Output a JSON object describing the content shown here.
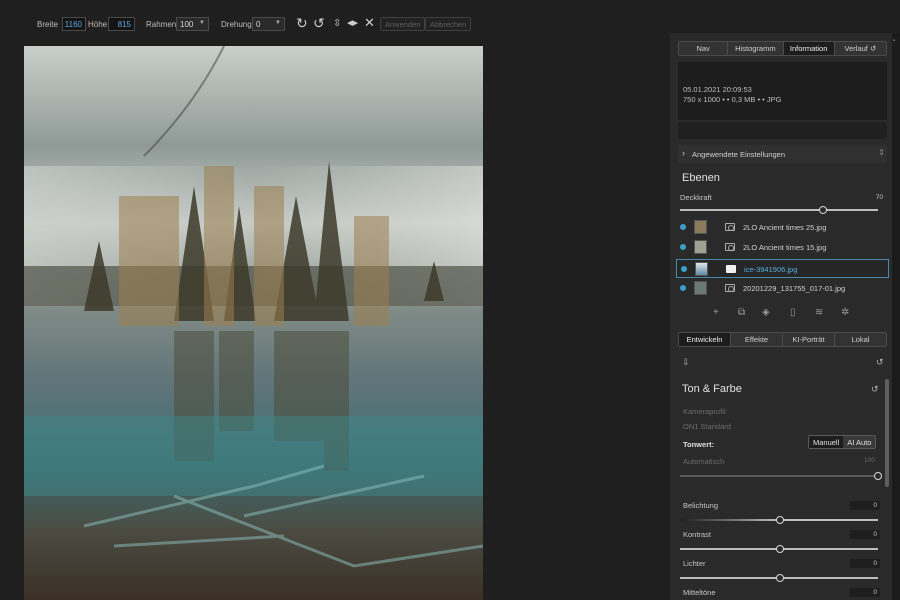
{
  "toolbar": {
    "width_label": "Breite",
    "width_value": "1160",
    "height_label": "Höhe",
    "height_value": "815",
    "frame_label": "Rahmen",
    "frame_value": "100",
    "rotation_label": "Drehung",
    "rotation_value": "0",
    "apply_label": "Anwenden",
    "cancel_label": "Abbrechen",
    "icons": [
      "rotate-cw-icon",
      "rotate-ccw-icon",
      "flip-vertical-icon",
      "flip-horizontal-icon",
      "fit-icon"
    ]
  },
  "panel": {
    "tabs": [
      {
        "label": "Nav"
      },
      {
        "label": "Histogramm"
      },
      {
        "label": "Information"
      },
      {
        "label": "Verlauf"
      }
    ],
    "info": {
      "datetime": "05.01.2021 20:09:53",
      "specs": "750 x 1000 • • 0,3 MB • • JPG"
    },
    "applied_settings": "Angewendete Einstellungen",
    "layers": {
      "title": "Ebenen",
      "opacity_label": "Deckkraft",
      "opacity_value": "70",
      "opacity_fraction": 0.72,
      "items": [
        {
          "name": "2LO Ancient times 25.jpg",
          "selected": false
        },
        {
          "name": "2LO Ancient times 15.jpg",
          "selected": false
        },
        {
          "name": "ice-3941906.jpg",
          "selected": true
        },
        {
          "name": "20201229_131755_017-01.jpg",
          "selected": false
        }
      ]
    },
    "mode_tabs": [
      {
        "label": "Entwickeln"
      },
      {
        "label": "Effekte"
      },
      {
        "label": "KI-Porträt"
      },
      {
        "label": "Lokal"
      }
    ],
    "tone": {
      "title": "Ton & Farbe",
      "camera_profile_label": "Kameraprofil:",
      "camera_profile_value": "ON1 Standard",
      "tonwert_label": "Tonwert:",
      "manual_label": "Manuell",
      "ai_label": "AI Auto",
      "auto_label": "Automatisch",
      "auto_value": "100",
      "sliders": [
        {
          "label": "Belichtung",
          "value": "0"
        },
        {
          "label": "Kontrast",
          "value": "0"
        },
        {
          "label": "Lichter",
          "value": "0"
        },
        {
          "label": "Mitteltöne",
          "value": "0"
        }
      ]
    }
  },
  "colors": {
    "accent": "#3ba0c8",
    "panel_bg": "#2a2a2a",
    "app_bg": "#1f1f1f"
  }
}
